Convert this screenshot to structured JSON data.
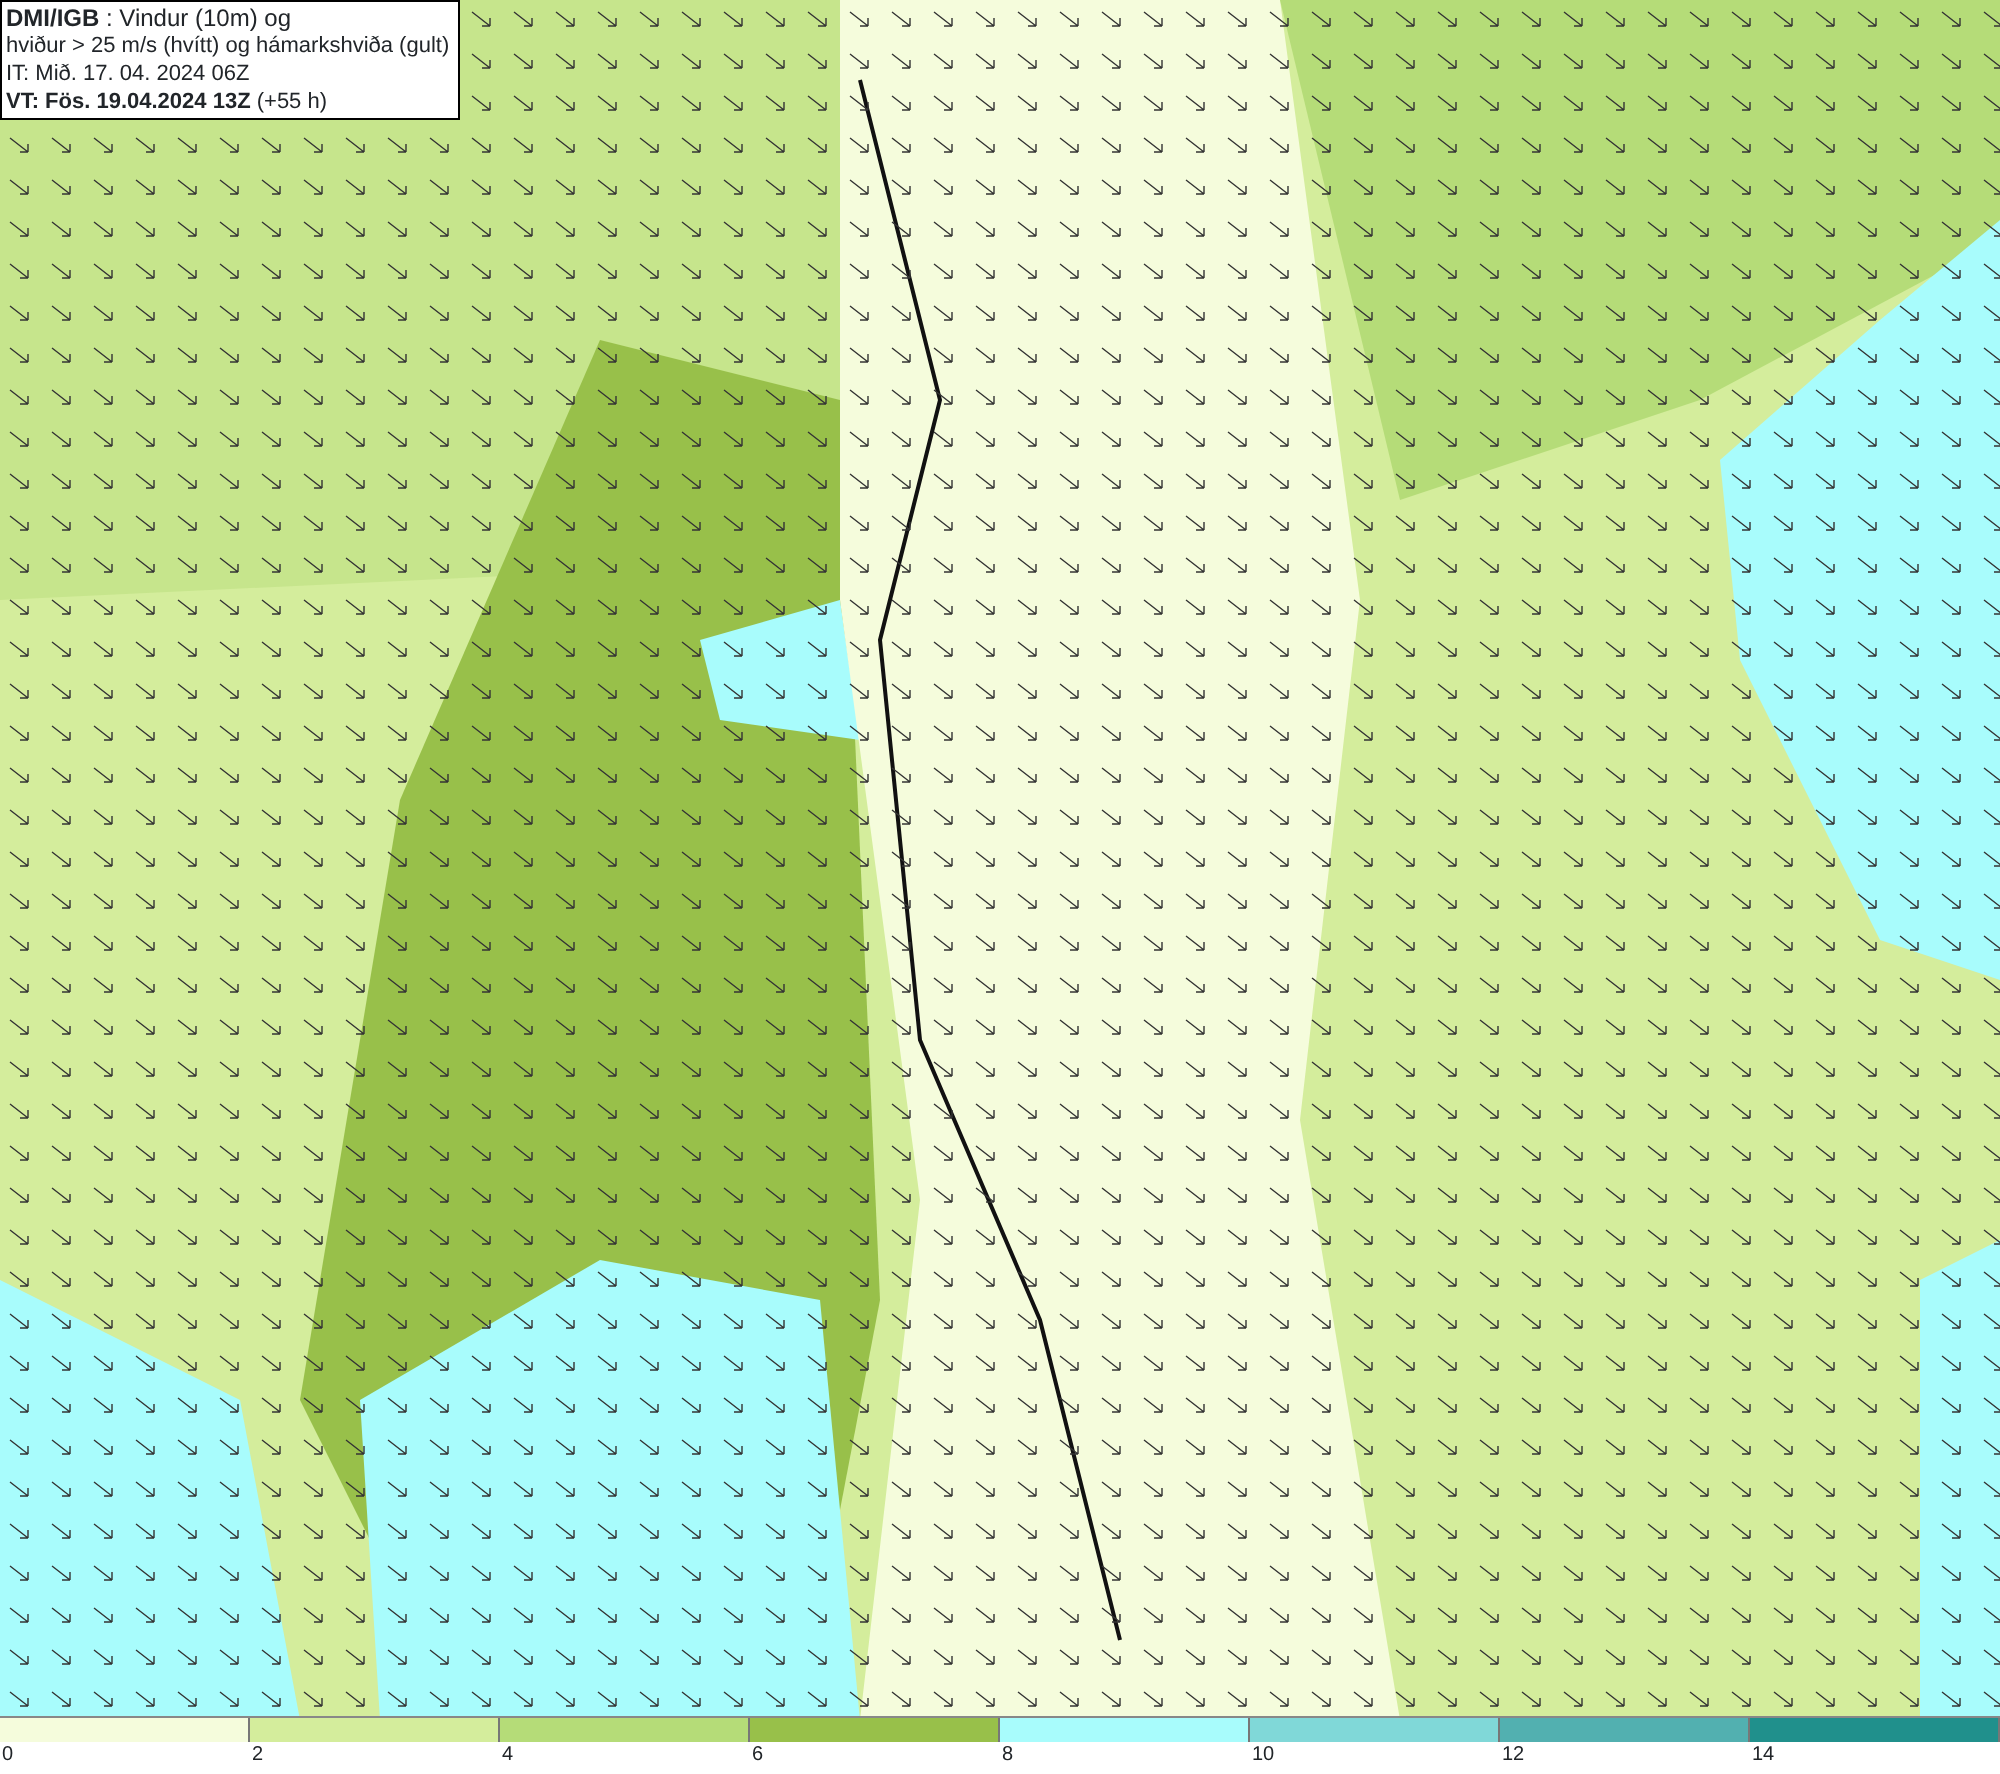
{
  "info_box": {
    "lines": [
      "**DMI/IGB** : Vindur (10m) og",
      "hviður > 25 m/s (hvítt) og hámarkshviða (gult)",
      "IT: Mið. 17. 04. 2024 06Z",
      "**VT: Fös. 19.04.2024 13Z** (+55 h)"
    ]
  },
  "legend": {
    "bins": [
      {
        "color": "#f5fcdc"
      },
      {
        "color": "#d4ed9c"
      },
      {
        "color": "#b5dc78"
      },
      {
        "color": "#98c04a"
      },
      {
        "color": "#a8fcfc"
      },
      {
        "color": "#80d8d8"
      },
      {
        "color": "#52b0b0"
      },
      {
        "color": "#20908c"
      }
    ],
    "ticks": [
      "0",
      "2",
      "4",
      "6",
      "8",
      "10",
      "12",
      "14"
    ]
  }
}
